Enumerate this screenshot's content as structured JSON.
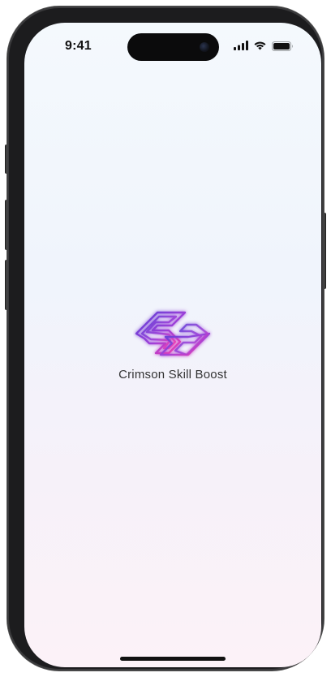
{
  "status_bar": {
    "time": "9:41",
    "icons": [
      "signal-icon",
      "wifi-icon",
      "battery-icon"
    ]
  },
  "splash": {
    "app_name": "Crimson Skill Boost",
    "logo": "crimson-skill-boost-logo"
  },
  "colors": {
    "logo_gradient_start": "#5b3fd6",
    "logo_gradient_end": "#ff3aa8",
    "text": "#333333",
    "background_top": "#f4f9fd",
    "background_bottom": "#fcf2f8"
  }
}
